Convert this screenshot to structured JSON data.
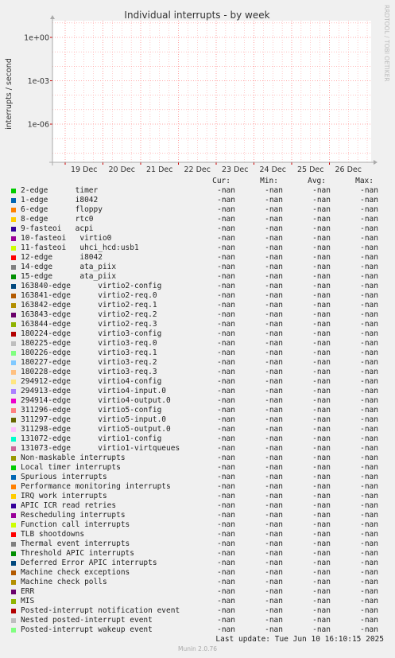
{
  "chart_data": {
    "type": "line",
    "title": "Individual interrupts - by week",
    "ylabel": "interrupts / second",
    "xlabel": "",
    "y_scale": "log",
    "y_ticks": [
      "1e+00",
      "1e-03",
      "1e-06"
    ],
    "y_tick_values": [
      1,
      0.001,
      1e-06
    ],
    "x_ticks": [
      "19 Dec",
      "20 Dec",
      "21 Dec",
      "22 Dec",
      "23 Dec",
      "24 Dec",
      "25 Dec",
      "26 Dec"
    ],
    "grid": true,
    "series_values": "-nan",
    "colors": {
      "plot_bg": "#ffffff",
      "grid": "#ff9999",
      "axis": "#aaaaaa",
      "tick": "#cc0000"
    }
  },
  "side_text": "RRDTOOL / TOBI OETIKER",
  "legend": {
    "headers": [
      "Cur:",
      "Min:",
      "Avg:",
      "Max:"
    ],
    "rows": [
      {
        "name": "2-edge      timer",
        "color": "#00cc00",
        "cur": "-nan",
        "min": "-nan",
        "avg": "-nan",
        "max": "-nan"
      },
      {
        "name": "1-edge      i8042",
        "color": "#0066b3",
        "cur": "-nan",
        "min": "-nan",
        "avg": "-nan",
        "max": "-nan"
      },
      {
        "name": "6-edge      floppy",
        "color": "#ff8000",
        "cur": "-nan",
        "min": "-nan",
        "avg": "-nan",
        "max": "-nan"
      },
      {
        "name": "8-edge      rtc0",
        "color": "#ffcc00",
        "cur": "-nan",
        "min": "-nan",
        "avg": "-nan",
        "max": "-nan"
      },
      {
        "name": "9-fasteoi   acpi",
        "color": "#330099",
        "cur": "-nan",
        "min": "-nan",
        "avg": "-nan",
        "max": "-nan"
      },
      {
        "name": "10-fasteoi   virtio0",
        "color": "#990099",
        "cur": "-nan",
        "min": "-nan",
        "avg": "-nan",
        "max": "-nan"
      },
      {
        "name": "11-fasteoi   uhci_hcd:usb1",
        "color": "#ccff00",
        "cur": "-nan",
        "min": "-nan",
        "avg": "-nan",
        "max": "-nan"
      },
      {
        "name": "12-edge      i8042",
        "color": "#ff0000",
        "cur": "-nan",
        "min": "-nan",
        "avg": "-nan",
        "max": "-nan"
      },
      {
        "name": "14-edge      ata_piix",
        "color": "#808080",
        "cur": "-nan",
        "min": "-nan",
        "avg": "-nan",
        "max": "-nan"
      },
      {
        "name": "15-edge      ata_piix",
        "color": "#008f00",
        "cur": "-nan",
        "min": "-nan",
        "avg": "-nan",
        "max": "-nan"
      },
      {
        "name": "163840-edge      virtio2-config",
        "color": "#00487d",
        "cur": "-nan",
        "min": "-nan",
        "avg": "-nan",
        "max": "-nan"
      },
      {
        "name": "163841-edge      virtio2-req.0",
        "color": "#b35a00",
        "cur": "-nan",
        "min": "-nan",
        "avg": "-nan",
        "max": "-nan"
      },
      {
        "name": "163842-edge      virtio2-req.1",
        "color": "#b38f00",
        "cur": "-nan",
        "min": "-nan",
        "avg": "-nan",
        "max": "-nan"
      },
      {
        "name": "163843-edge      virtio2-req.2",
        "color": "#6b006b",
        "cur": "-nan",
        "min": "-nan",
        "avg": "-nan",
        "max": "-nan"
      },
      {
        "name": "163844-edge      virtio2-req.3",
        "color": "#8fb300",
        "cur": "-nan",
        "min": "-nan",
        "avg": "-nan",
        "max": "-nan"
      },
      {
        "name": "180224-edge      virtio3-config",
        "color": "#b30000",
        "cur": "-nan",
        "min": "-nan",
        "avg": "-nan",
        "max": "-nan"
      },
      {
        "name": "180225-edge      virtio3-req.0",
        "color": "#bebebe",
        "cur": "-nan",
        "min": "-nan",
        "avg": "-nan",
        "max": "-nan"
      },
      {
        "name": "180226-edge      virtio3-req.1",
        "color": "#80ff80",
        "cur": "-nan",
        "min": "-nan",
        "avg": "-nan",
        "max": "-nan"
      },
      {
        "name": "180227-edge      virtio3-req.2",
        "color": "#80c9ff",
        "cur": "-nan",
        "min": "-nan",
        "avg": "-nan",
        "max": "-nan"
      },
      {
        "name": "180228-edge      virtio3-req.3",
        "color": "#ffc080",
        "cur": "-nan",
        "min": "-nan",
        "avg": "-nan",
        "max": "-nan"
      },
      {
        "name": "294912-edge      virtio4-config",
        "color": "#ffe680",
        "cur": "-nan",
        "min": "-nan",
        "avg": "-nan",
        "max": "-nan"
      },
      {
        "name": "294913-edge      virtio4-input.0",
        "color": "#aa80ff",
        "cur": "-nan",
        "min": "-nan",
        "avg": "-nan",
        "max": "-nan"
      },
      {
        "name": "294914-edge      virtio4-output.0",
        "color": "#ee00cc",
        "cur": "-nan",
        "min": "-nan",
        "avg": "-nan",
        "max": "-nan"
      },
      {
        "name": "311296-edge      virtio5-config",
        "color": "#ff8080",
        "cur": "-nan",
        "min": "-nan",
        "avg": "-nan",
        "max": "-nan"
      },
      {
        "name": "311297-edge      virtio5-input.0",
        "color": "#666600",
        "cur": "-nan",
        "min": "-nan",
        "avg": "-nan",
        "max": "-nan"
      },
      {
        "name": "311298-edge      virtio5-output.0",
        "color": "#ffbfff",
        "cur": "-nan",
        "min": "-nan",
        "avg": "-nan",
        "max": "-nan"
      },
      {
        "name": "131072-edge      virtio1-config",
        "color": "#00ffcc",
        "cur": "-nan",
        "min": "-nan",
        "avg": "-nan",
        "max": "-nan"
      },
      {
        "name": "131073-edge      virtio1-virtqueues",
        "color": "#cc6699",
        "cur": "-nan",
        "min": "-nan",
        "avg": "-nan",
        "max": "-nan"
      },
      {
        "name": "Non-maskable interrupts",
        "color": "#999900",
        "cur": "-nan",
        "min": "-nan",
        "avg": "-nan",
        "max": "-nan"
      },
      {
        "name": "Local timer interrupts",
        "color": "#00cc00",
        "cur": "-nan",
        "min": "-nan",
        "avg": "-nan",
        "max": "-nan"
      },
      {
        "name": "Spurious interrupts",
        "color": "#0066b3",
        "cur": "-nan",
        "min": "-nan",
        "avg": "-nan",
        "max": "-nan"
      },
      {
        "name": "Performance monitoring interrupts",
        "color": "#ff8000",
        "cur": "-nan",
        "min": "-nan",
        "avg": "-nan",
        "max": "-nan"
      },
      {
        "name": "IRQ work interrupts",
        "color": "#ffcc00",
        "cur": "-nan",
        "min": "-nan",
        "avg": "-nan",
        "max": "-nan"
      },
      {
        "name": "APIC ICR read retries",
        "color": "#330099",
        "cur": "-nan",
        "min": "-nan",
        "avg": "-nan",
        "max": "-nan"
      },
      {
        "name": "Rescheduling interrupts",
        "color": "#990099",
        "cur": "-nan",
        "min": "-nan",
        "avg": "-nan",
        "max": "-nan"
      },
      {
        "name": "Function call interrupts",
        "color": "#ccff00",
        "cur": "-nan",
        "min": "-nan",
        "avg": "-nan",
        "max": "-nan"
      },
      {
        "name": "TLB shootdowns",
        "color": "#ff0000",
        "cur": "-nan",
        "min": "-nan",
        "avg": "-nan",
        "max": "-nan"
      },
      {
        "name": "Thermal event interrupts",
        "color": "#808080",
        "cur": "-nan",
        "min": "-nan",
        "avg": "-nan",
        "max": "-nan"
      },
      {
        "name": "Threshold APIC interrupts",
        "color": "#008f00",
        "cur": "-nan",
        "min": "-nan",
        "avg": "-nan",
        "max": "-nan"
      },
      {
        "name": "Deferred Error APIC interrupts",
        "color": "#00487d",
        "cur": "-nan",
        "min": "-nan",
        "avg": "-nan",
        "max": "-nan"
      },
      {
        "name": "Machine check exceptions",
        "color": "#b35a00",
        "cur": "-nan",
        "min": "-nan",
        "avg": "-nan",
        "max": "-nan"
      },
      {
        "name": "Machine check polls",
        "color": "#b38f00",
        "cur": "-nan",
        "min": "-nan",
        "avg": "-nan",
        "max": "-nan"
      },
      {
        "name": "ERR",
        "color": "#6b006b",
        "cur": "-nan",
        "min": "-nan",
        "avg": "-nan",
        "max": "-nan"
      },
      {
        "name": "MIS",
        "color": "#8fb300",
        "cur": "-nan",
        "min": "-nan",
        "avg": "-nan",
        "max": "-nan"
      },
      {
        "name": "Posted-interrupt notification event",
        "color": "#b30000",
        "cur": "-nan",
        "min": "-nan",
        "avg": "-nan",
        "max": "-nan"
      },
      {
        "name": "Nested posted-interrupt event",
        "color": "#bebebe",
        "cur": "-nan",
        "min": "-nan",
        "avg": "-nan",
        "max": "-nan"
      },
      {
        "name": "Posted-interrupt wakeup event",
        "color": "#80ff80",
        "cur": "-nan",
        "min": "-nan",
        "avg": "-nan",
        "max": "-nan"
      }
    ]
  },
  "footer": {
    "last_update": "Last update: Tue Jun 10 16:10:15 2025",
    "version": "Munin 2.0.76"
  }
}
